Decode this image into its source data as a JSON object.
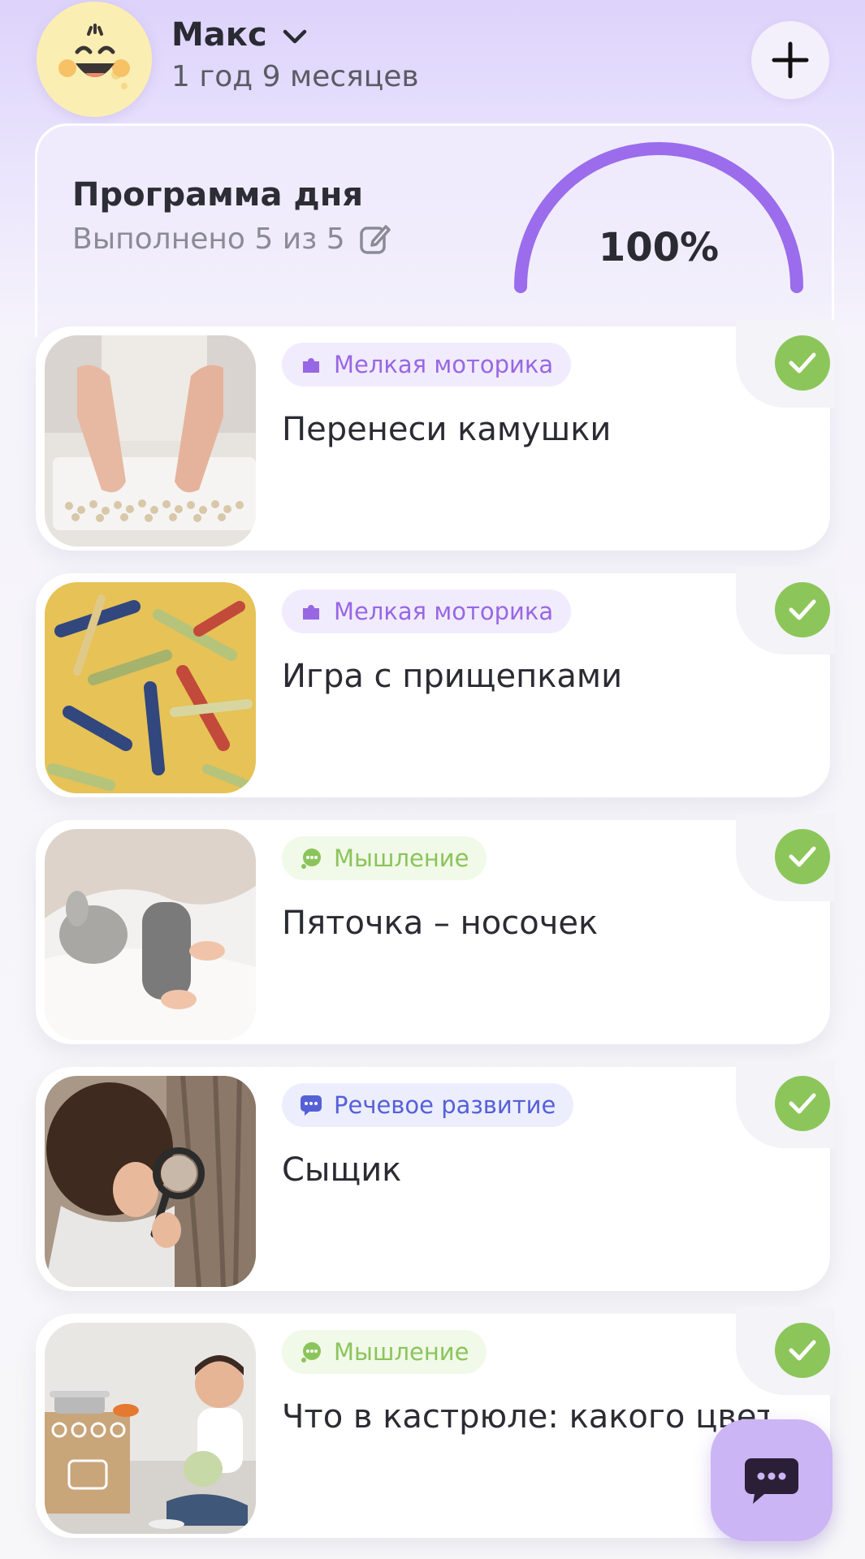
{
  "header": {
    "child_name": "Макс",
    "child_age": "1 год 9 месяцев",
    "avatar_icon": "smiley-face-icon",
    "add_icon": "plus-icon"
  },
  "program": {
    "title": "Программа дня",
    "subtitle": "Выполнено 5 из 5",
    "completed": 5,
    "total": 5,
    "progress_label": "100%",
    "progress_fraction": 1.0,
    "accent_color": "#9b6cec"
  },
  "activities": [
    {
      "category": "Мелкая моторика",
      "category_icon": "puzzle-icon",
      "title": "Перенеси камушки",
      "done": true
    },
    {
      "category": "Мелкая моторика",
      "category_icon": "puzzle-icon",
      "title": "Игра с прищепками",
      "done": true
    },
    {
      "category": "Мышление",
      "category_icon": "thought-bubble-icon",
      "title": "Пяточка – носочек",
      "done": true
    },
    {
      "category": "Речевое развитие",
      "category_icon": "speech-bubble-icon",
      "title": "Сыщик",
      "done": true
    },
    {
      "category": "Мышление",
      "category_icon": "thought-bubble-icon",
      "title": "Что в кастрюле: какого цвета",
      "done": true
    }
  ],
  "colors": {
    "motor": "#9867e4",
    "thinking": "#8bc45b",
    "speech": "#5560d8",
    "check": "#8cc65a",
    "chat_button": "#cbb5f5"
  },
  "chat_icon": "chat-bubble-icon"
}
